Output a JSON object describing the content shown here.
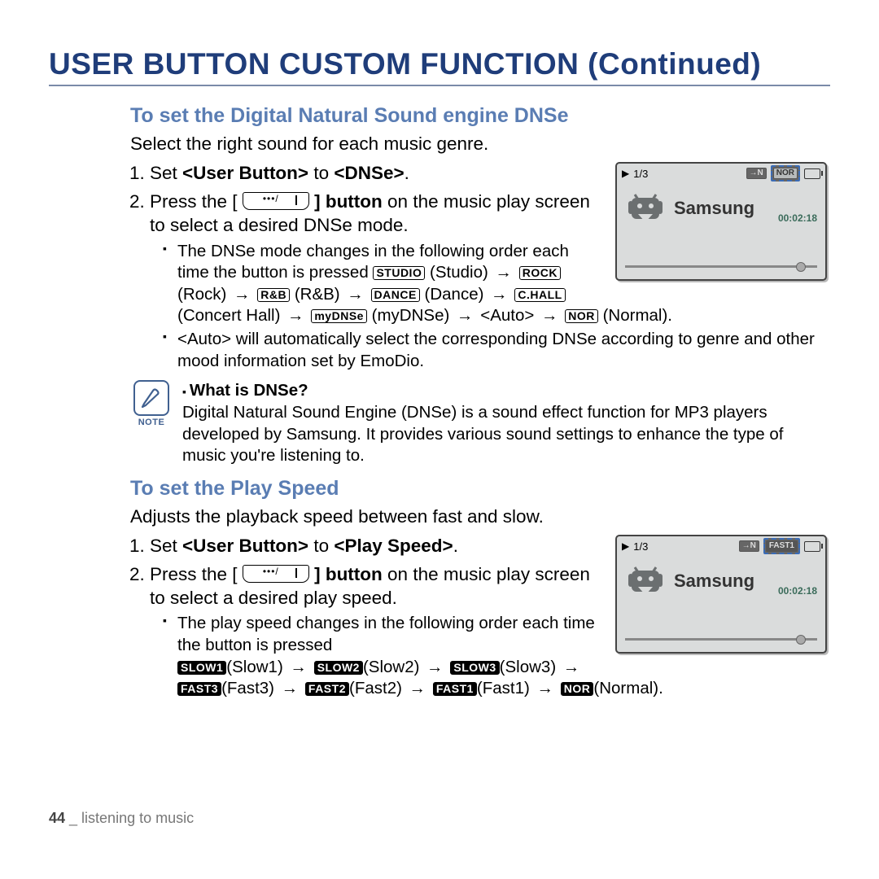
{
  "title": "USER BUTTON CUSTOM FUNCTION (Continued)",
  "section1": {
    "heading": "To set the Digital Natural Sound engine DNSe",
    "intro": "Select the right sound for each music genre.",
    "step1_pre": "Set ",
    "step1_user_button": "<User Button>",
    "step1_mid": " to ",
    "step1_target": "<DNSe>",
    "step1_post": ".",
    "step2_pre": "Press the [",
    "step2_mid": "] button",
    "step2_post": " on the music play screen to select a desired DNSe mode.",
    "bullet1": "The DNSe mode changes in the following order each time the button is pressed ",
    "tags": {
      "studio": "STUDIO",
      "studio_txt": "(Studio)",
      "rock": "ROCK",
      "rock_txt": "(Rock)",
      "rnb": "R&B",
      "rnb_txt": "(R&B)",
      "dance": "DANCE",
      "dance_txt": "(Dance)",
      "chall": "C.HALL",
      "chall_txt": "(Concert Hall)",
      "mydnse": "myDNSe",
      "mydnse_txt": "(myDNSe)",
      "auto_txt": "<Auto>",
      "nor": "NOR",
      "nor_txt": "(Normal)."
    },
    "bullet2": "<Auto> will automatically select the corresponding DNSe according to genre and other mood information set by EmoDio.",
    "note_label": "NOTE",
    "note_q": "What is DNSe?",
    "note_body": "Digital Natural Sound Engine (DNSe) is a sound effect function for MP3 players developed by Samsung. It provides various sound settings to enhance the type of music you're listening to."
  },
  "section2": {
    "heading": "To set the Play Speed",
    "intro": "Adjusts the playback speed between fast and slow.",
    "step1_pre": "Set ",
    "step1_user_button": "<User Button>",
    "step1_mid": " to ",
    "step1_target": "<Play Speed>",
    "step1_post": ".",
    "step2_pre": "Press the [",
    "step2_mid": "] button",
    "step2_post": " on the music play screen to select a desired play speed.",
    "bullet1": "The play speed changes in the following order each time the button is pressed",
    "tags": {
      "slow1": "SLOW1",
      "slow1_txt": "(Slow1)",
      "slow2": "SLOW2",
      "slow2_txt": "(Slow2)",
      "slow3": "SLOW3",
      "slow3_txt": "(Slow3)",
      "fast3": "FAST3",
      "fast3_txt": "(Fast3)",
      "fast2": "FAST2",
      "fast2_txt": "(Fast2)",
      "fast1": "FAST1",
      "fast1_txt": "(Fast1)",
      "nor": "NOR",
      "nor_txt": "(Normal)."
    }
  },
  "screen": {
    "counter": "1/3",
    "nor_tag": "NOR",
    "fast1_tag": "FAST1",
    "title": "Samsung",
    "time": "00:02:18",
    "arrow_ind": "→N"
  },
  "arrow": "→",
  "footer": {
    "page": "44",
    "sep": " _ ",
    "chapter": "listening to music"
  }
}
